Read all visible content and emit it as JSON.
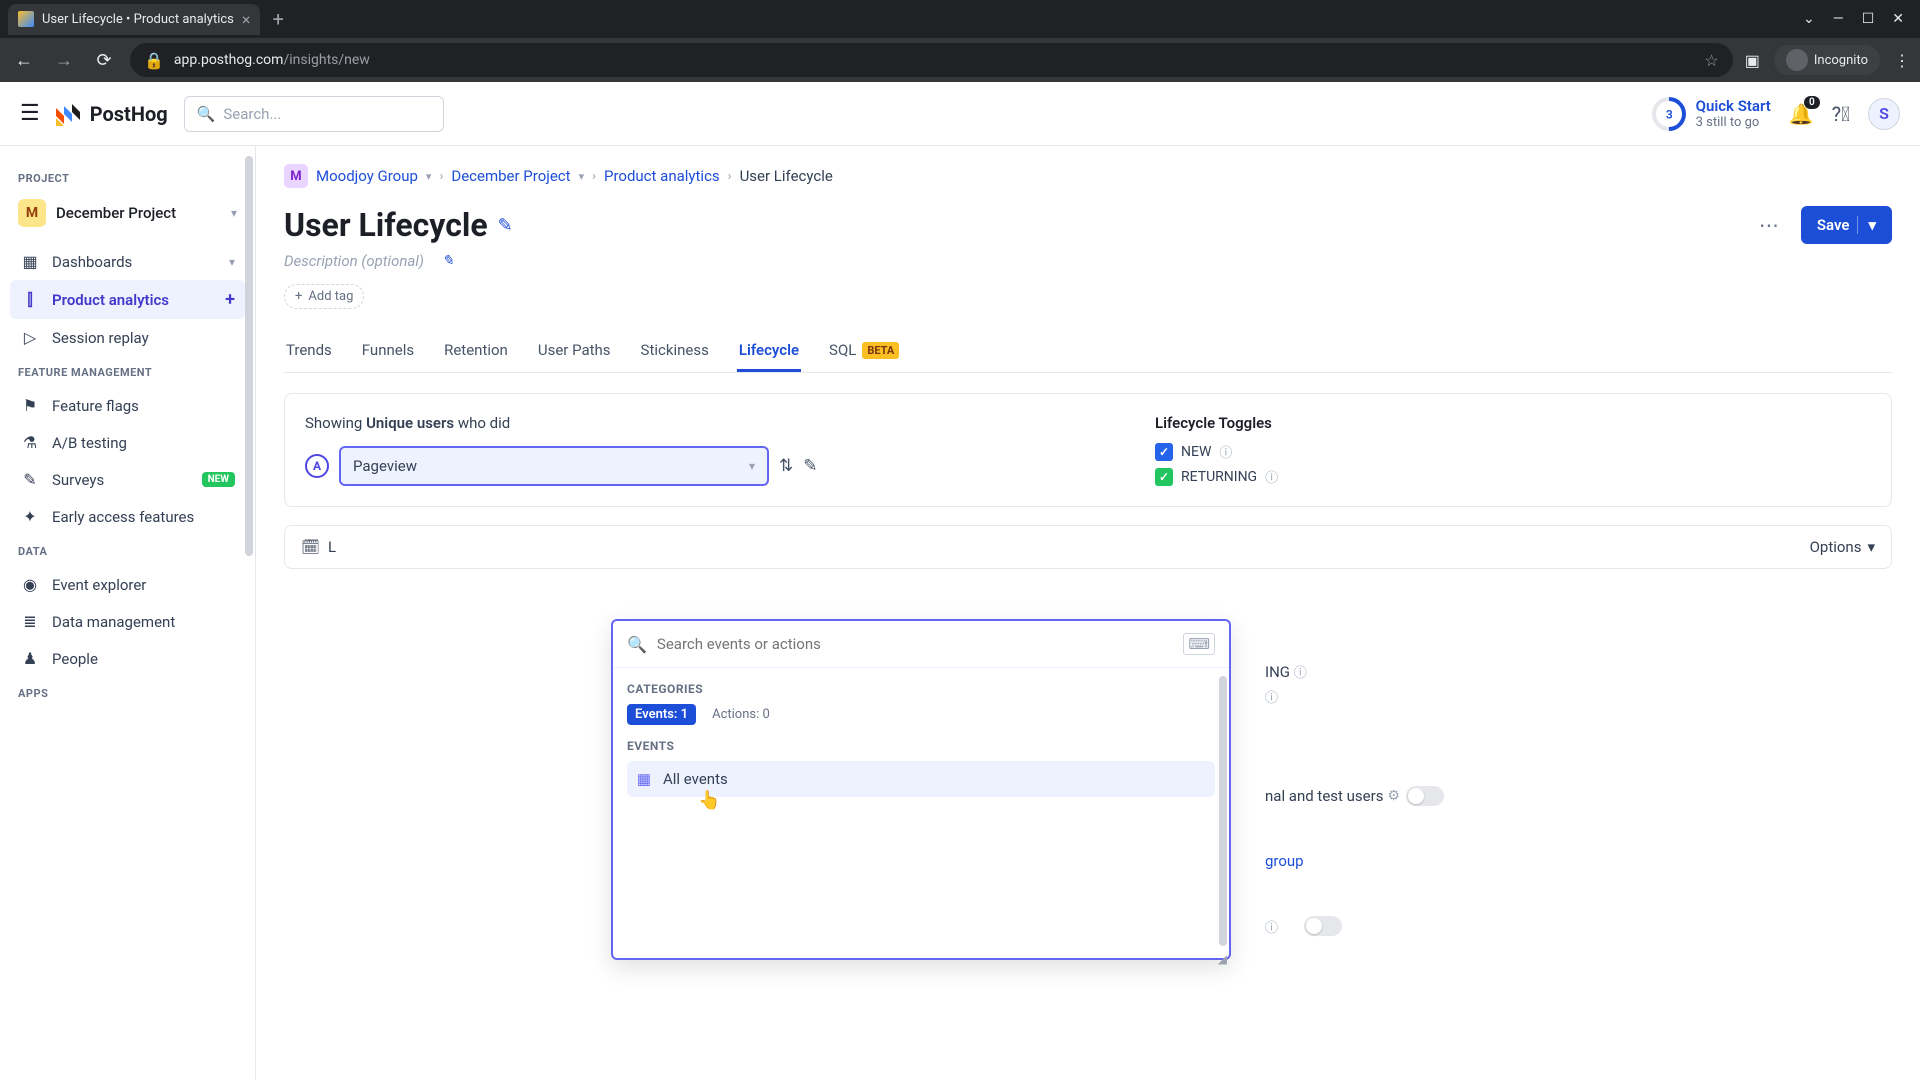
{
  "browser": {
    "tab_title": "User Lifecycle • Product analytics",
    "url_host": "app.posthog.com",
    "url_path": "/insights/new",
    "incognito": "Incognito"
  },
  "topbar": {
    "logo": "PostHog",
    "search_placeholder": "Search...",
    "quickstart_title": "Quick Start",
    "quickstart_sub": "3 still to go",
    "progress": "3",
    "notif_count": "0",
    "avatar_initial": "S"
  },
  "sidebar": {
    "section_project": "PROJECT",
    "project_initial": "M",
    "project_name": "December Project",
    "items_main": [
      {
        "icon": "▭",
        "label": "Dashboards",
        "trailing": "chev"
      },
      {
        "icon": "⫿",
        "label": "Product analytics",
        "active": true,
        "trailing": "plus"
      },
      {
        "icon": "▷",
        "label": "Session replay"
      }
    ],
    "section_feature": "FEATURE MANAGEMENT",
    "items_feature": [
      {
        "icon": "⚑",
        "label": "Feature flags"
      },
      {
        "icon": "⧉",
        "label": "A/B testing"
      },
      {
        "icon": "✎",
        "label": "Surveys",
        "new": "NEW"
      },
      {
        "icon": "✦",
        "label": "Early access features"
      }
    ],
    "section_data": "DATA",
    "items_data": [
      {
        "icon": "◈",
        "label": "Event explorer"
      },
      {
        "icon": "≣",
        "label": "Data management"
      },
      {
        "icon": "♟",
        "label": "People"
      }
    ],
    "section_apps": "APPS"
  },
  "breadcrumbs": {
    "org_initial": "M",
    "org": "Moodjoy Group",
    "project": "December Project",
    "area": "Product analytics",
    "current": "User Lifecycle"
  },
  "page": {
    "title": "User Lifecycle",
    "description_placeholder": "Description (optional)",
    "add_tag": "Add tag",
    "save": "Save"
  },
  "tabs": [
    "Trends",
    "Funnels",
    "Retention",
    "User Paths",
    "Stickiness",
    "Lifecycle",
    "SQL"
  ],
  "tabs_active": "Lifecycle",
  "sql_beta": "BETA",
  "panel": {
    "showing_prefix": "Showing ",
    "showing_bold": "Unique users",
    "showing_suffix": " who did",
    "series_letter": "A",
    "event_value": "Pageview"
  },
  "toggles": {
    "title": "Lifecycle Toggles",
    "items": [
      {
        "label": "NEW",
        "color": "blue"
      },
      {
        "label": "RETURNING",
        "color": "green"
      },
      {
        "label_partial": "ING"
      },
      {
        "label_partial2": ""
      }
    ]
  },
  "popup": {
    "search_placeholder": "Search events or actions",
    "cat_label": "CATEGORIES",
    "events_pill": "Events: 1",
    "actions_pill": "Actions: 0",
    "events_label": "EVENTS",
    "item": "All events"
  },
  "hidden_controls": {
    "test_users": "nal and test users",
    "group": "group",
    "options": "Options",
    "date_prefix": "L"
  }
}
